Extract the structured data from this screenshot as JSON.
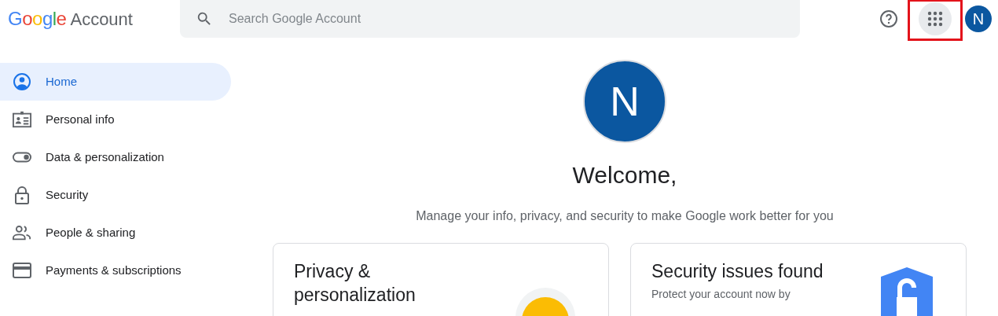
{
  "header": {
    "logo": "Google",
    "product": "Account",
    "search": {
      "placeholder": "Search Google Account"
    },
    "apps_button": {
      "highlighted": true
    },
    "avatar_initial": "N"
  },
  "sidebar": {
    "items": [
      {
        "label": "Home",
        "kind": "home",
        "selected": true
      },
      {
        "label": "Personal info",
        "kind": "id",
        "selected": false
      },
      {
        "label": "Data & personalization",
        "kind": "toggle",
        "selected": false
      },
      {
        "label": "Security",
        "kind": "lock",
        "selected": false
      },
      {
        "label": "People & sharing",
        "kind": "people",
        "selected": false
      },
      {
        "label": "Payments & subscriptions",
        "kind": "card",
        "selected": false
      }
    ]
  },
  "main": {
    "avatar_initial": "N",
    "welcome": "Welcome,",
    "subtitle": "Manage your info, privacy, and security to make Google work better for you",
    "cards": [
      {
        "kind": "privacy",
        "title": "Privacy & personalization"
      },
      {
        "kind": "security",
        "title": "Security issues found",
        "text": "Protect your account now by"
      }
    ]
  }
}
